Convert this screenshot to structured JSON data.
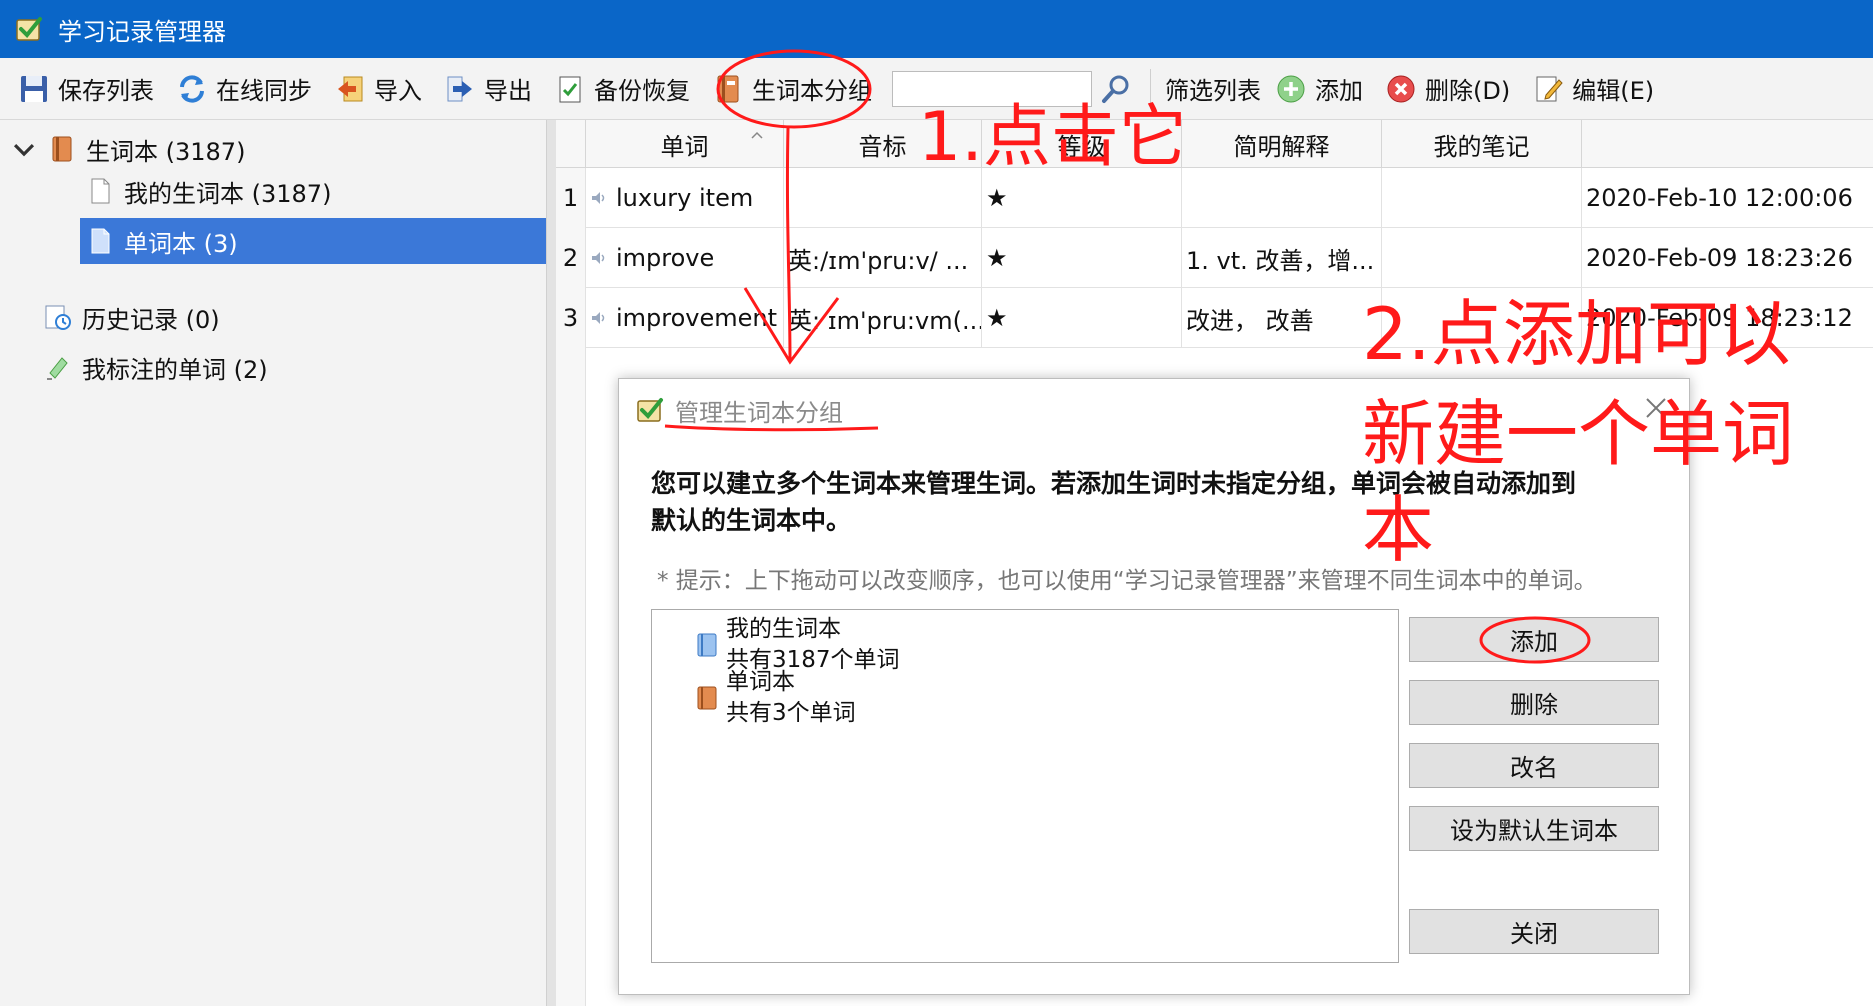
{
  "window": {
    "title": "学习记录管理器",
    "accent_color": "#0a66c8"
  },
  "toolbar": {
    "save_list": "保存列表",
    "sync": "在线同步",
    "import": "导入",
    "export": "导出",
    "backup": "备份恢复",
    "notebook_groups": "生词本分组",
    "search_value": "",
    "filter_list": "筛选列表",
    "add": "添加",
    "delete": "删除(D)",
    "edit": "编辑(E)"
  },
  "sidebar": {
    "root": "生词本 (3187)",
    "child_1": "我的生词本 (3187)",
    "child_2": "单词本 (3)",
    "history": "历史记录 (0)",
    "marked": "我标注的单词 (2)"
  },
  "table": {
    "headers": {
      "word": "单词",
      "phonetic": "音标",
      "level": "等级",
      "definition": "简明解释",
      "notes": "我的笔记"
    },
    "rows": [
      {
        "num": "1",
        "word": "luxury item",
        "phonetic": "",
        "level": "★",
        "definition": "",
        "notes": "",
        "time": "2020-Feb-10 12:00:06"
      },
      {
        "num": "2",
        "word": "improve",
        "phonetic": "英:/ɪm'pru:v/ ...",
        "level": "★",
        "definition": "1. vt. 改善，增...",
        "notes": "",
        "time": "2020-Feb-09 18:23:26"
      },
      {
        "num": "3",
        "word": "improvement",
        "phonetic": "英: ɪm'pru:vm(...",
        "level": "★",
        "definition": "改进， 改善",
        "notes": "",
        "time": "2020-Feb-09 18:23:12"
      }
    ]
  },
  "dialog": {
    "title": "管理生词本分组",
    "description_line1": "您可以建立多个生词本来管理生词。若添加生词时未指定分组，单词会被自动添加到",
    "description_line2": "默认的生词本中。",
    "hint": "* 提示：上下拖动可以改变顺序，也可以使用“学习记录管理器”来管理不同生词本中的单词。",
    "notebooks": [
      {
        "name": "我的生词本",
        "count": "共有3187个单词"
      },
      {
        "name": "单词本",
        "count": "共有3个单词"
      }
    ],
    "buttons": {
      "add": "添加",
      "delete": "删除",
      "rename": "改名",
      "set_default": "设为默认生词本",
      "close": "关闭"
    }
  },
  "annotations": {
    "step1": "1.点击它",
    "step2_line1": "2.点添加可以",
    "step2_line2": "新建一个单词",
    "step2_line3": "本",
    "color": "#ff1a1a"
  }
}
